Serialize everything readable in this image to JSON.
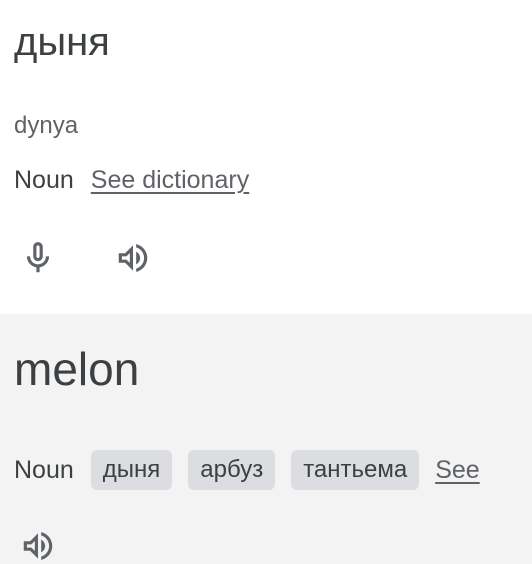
{
  "source": {
    "word": "дыня",
    "transliteration": "dynya",
    "part_of_speech": "Noun",
    "dictionary_link": "See dictionary",
    "icons": [
      "microphone-icon",
      "speaker-icon"
    ]
  },
  "target": {
    "word": "melon",
    "part_of_speech": "Noun",
    "synonyms": [
      "дыня",
      "арбуз",
      "тантьема"
    ],
    "more_link": "See",
    "icons": [
      "speaker-icon"
    ]
  },
  "colors": {
    "text_primary": "#3c4043",
    "text_secondary": "#5f6368",
    "chip_background": "#dcdde0",
    "target_background": "#f3f3f3"
  }
}
